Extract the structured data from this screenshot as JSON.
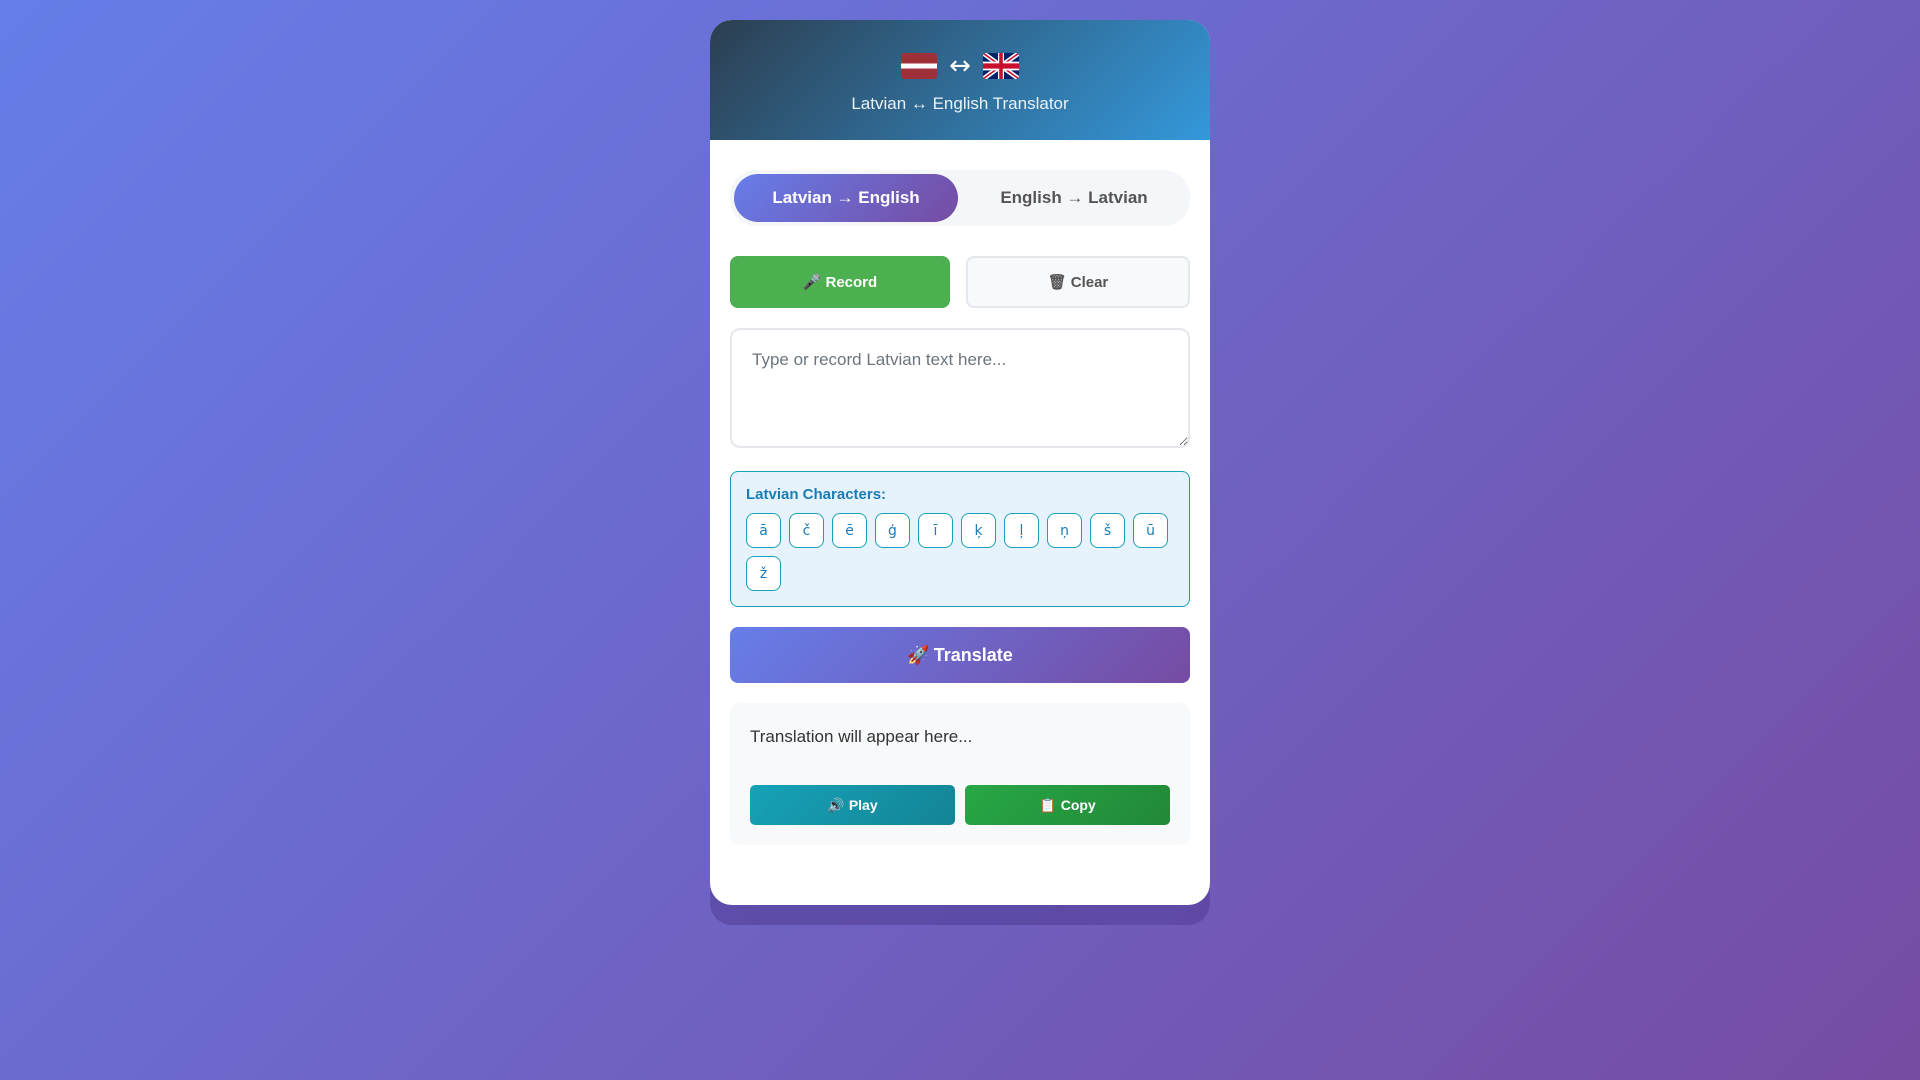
{
  "header": {
    "flag_left": "latvian-flag-icon",
    "flag_right": "uk-flag-icon",
    "arrows": "↔",
    "title": "Latvian ↔ English Translator"
  },
  "mode": {
    "options": [
      {
        "label": "Latvian → English",
        "active": true
      },
      {
        "label": "English → Latvian",
        "active": false
      }
    ]
  },
  "actions": {
    "record_icon": "microphone-icon",
    "record_label": "Record",
    "clear_icon": "trash-icon",
    "clear_label": "Clear"
  },
  "input": {
    "placeholder": "Type or record Latvian text here...",
    "value": ""
  },
  "characters": {
    "title": "Latvian Characters:",
    "items": [
      "ā",
      "č",
      "ē",
      "ģ",
      "ī",
      "ķ",
      "ļ",
      "ņ",
      "š",
      "ū",
      "ž"
    ]
  },
  "translate": {
    "icon": "rocket-icon",
    "label": "Translate"
  },
  "output": {
    "placeholder": "Translation will appear here...",
    "play_icon": "speaker-icon",
    "play_label": "Play",
    "copy_icon": "clipboard-icon",
    "copy_label": "Copy"
  },
  "colors": {
    "background_start": "#667eea",
    "background_end": "#764ba2",
    "header_start": "#2c3e50",
    "header_end": "#3498db",
    "record": "#4caf50",
    "play": "#17a2b8",
    "copy": "#28a745"
  }
}
